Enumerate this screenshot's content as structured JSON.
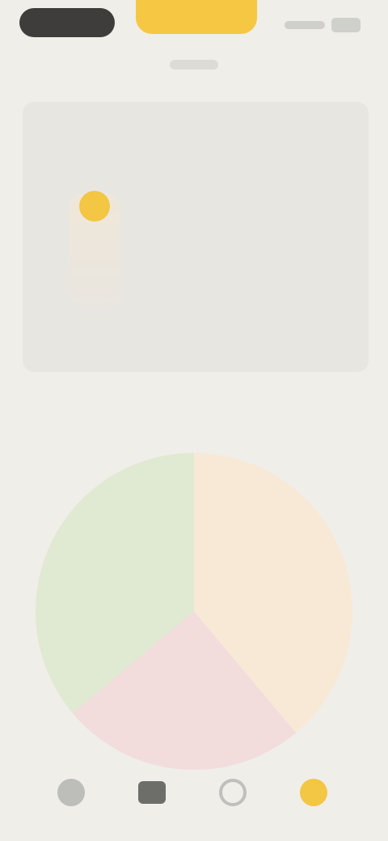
{
  "topbar": {
    "left_button": "",
    "center_button": "",
    "subtitle": ""
  },
  "card": {
    "title": ""
  },
  "section": {
    "title": ""
  },
  "pie": {
    "labels": [
      "",
      "",
      ""
    ],
    "colors": [
      "#F8E9D7",
      "#F2DCDC",
      "#E0E9D1"
    ]
  },
  "navbar": {
    "items": [
      {
        "icon": "home-icon"
      },
      {
        "icon": "grid-icon"
      },
      {
        "icon": "stats-icon"
      },
      {
        "icon": "profile-icon"
      }
    ]
  },
  "colors": {
    "accent": "#F6C742",
    "background": "#EFEEE9",
    "card": "#E8E6E1",
    "dark_pill": "#3E3D3B"
  }
}
